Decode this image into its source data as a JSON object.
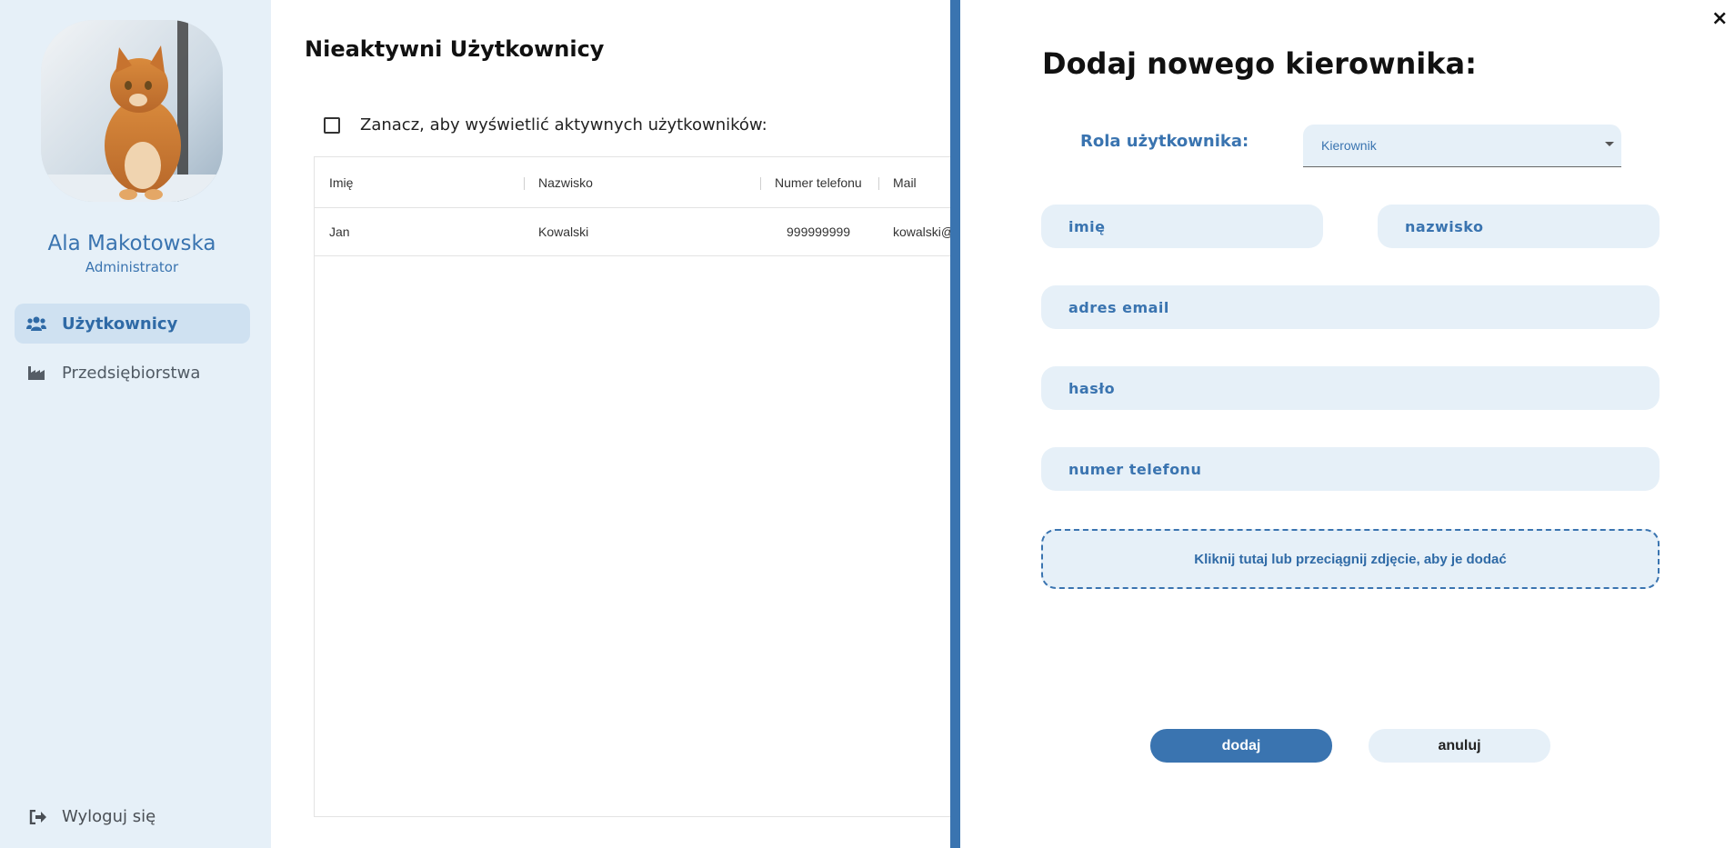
{
  "sidebar": {
    "user_name": "Ala Makotowska",
    "user_role": "Administrator",
    "nav": [
      {
        "label": "Użytkownicy",
        "icon": "users-icon",
        "active": true
      },
      {
        "label": "Przedsiębiorstwa",
        "icon": "industry-icon",
        "active": false
      }
    ],
    "logout_label": "Wyloguj się"
  },
  "main": {
    "title": "Nieaktywni Użytkownicy",
    "toggle_label": "Zanacz, aby wyświetlić aktywnych użytkowników:",
    "table": {
      "headers": [
        "Imię",
        "Nazwisko",
        "Numer telefonu",
        "Mail"
      ],
      "rows": [
        [
          "Jan",
          "Kowalski",
          "999999999",
          "kowalski@"
        ]
      ]
    }
  },
  "drawer": {
    "close": "×",
    "title": "Dodaj nowego kierownika:",
    "role_label": "Rola użytkownika:",
    "role_value": "Kierownik",
    "fields": {
      "first_name": "imię",
      "last_name": "nazwisko",
      "email": "adres email",
      "password": "hasło",
      "phone": "numer telefonu"
    },
    "dropzone": "Kliknij tutaj lub przeciągnij zdjęcie, aby je dodać",
    "submit": "dodaj",
    "cancel": "anuluj"
  },
  "colors": {
    "accent": "#3a74b0",
    "sidebar_bg": "#e6f0f8",
    "active_nav_bg": "#cfe1f1"
  }
}
